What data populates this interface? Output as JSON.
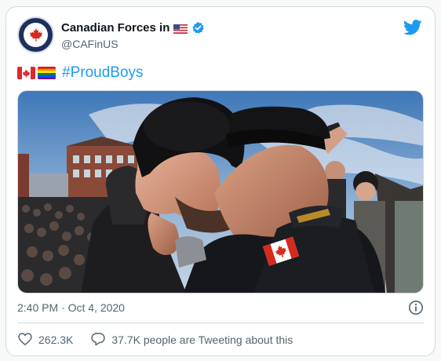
{
  "tweet": {
    "author_name": "Canadian Forces in",
    "author_handle": "@CAFinUS",
    "hashtag": "#ProudBoys",
    "timestamp": "2:40 PM · Oct 4, 2020",
    "likes": "262.3K",
    "tweeting_text": "37.7K people are Tweeting about this"
  },
  "icons": {
    "avatar": "canadian-forces-roundel",
    "author_flag": "us-flag-emoji",
    "verified": "verified-badge-icon",
    "logo": "twitter-bird-icon",
    "text_emoji_1": "canada-flag-emoji",
    "text_emoji_2": "rainbow-flag-emoji",
    "info": "info-icon",
    "like": "heart-icon",
    "reply": "speech-bubble-icon"
  },
  "colors": {
    "accent": "#1d9bf0",
    "text": "#0f1419",
    "secondary": "#536471",
    "border": "#cfd9de"
  }
}
